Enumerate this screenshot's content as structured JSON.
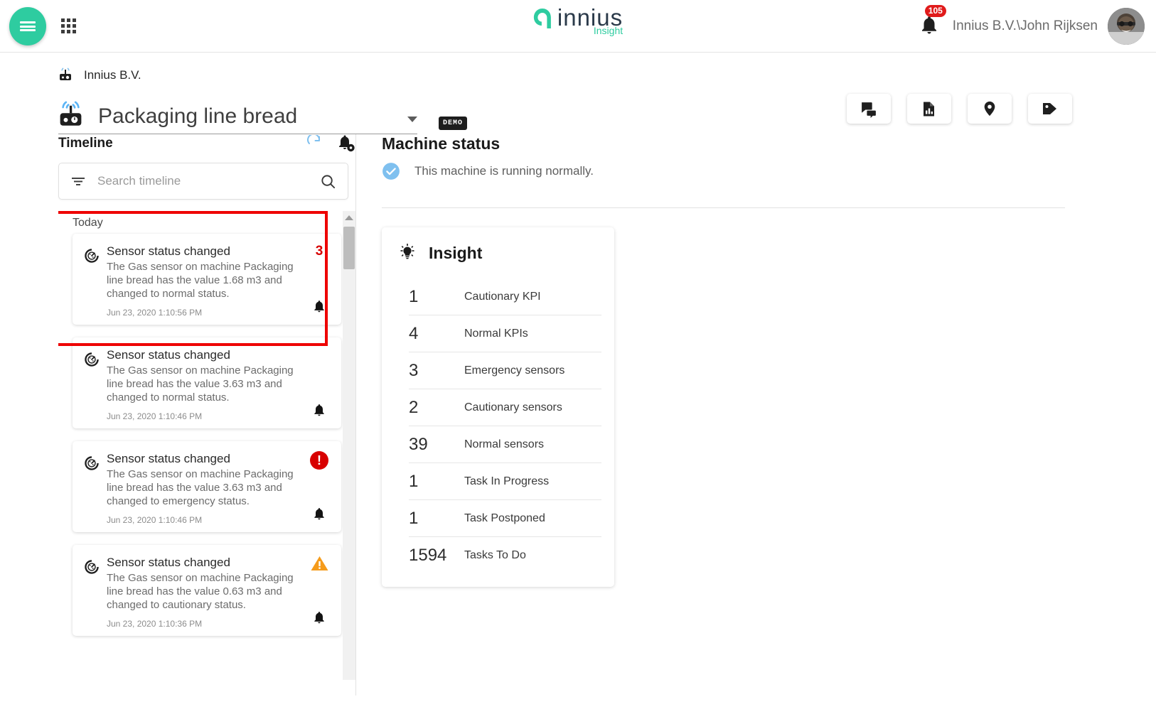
{
  "header": {
    "menu_icon": "hamburger-icon",
    "apps_icon": "apps-grid-icon",
    "brand_word": "innius",
    "brand_sub": "Insight",
    "notification_count": "105",
    "user_name": "Innius B.V.\\John Rijksen"
  },
  "page": {
    "breadcrumb": "Innius B.V.",
    "machine_title": "Packaging line bread",
    "demo_chip": "DEMO",
    "actions": [
      {
        "name": "comments-button",
        "icon": "chat-bubbles-icon"
      },
      {
        "name": "reports-button",
        "icon": "document-chart-icon"
      },
      {
        "name": "location-button",
        "icon": "map-pin-icon"
      },
      {
        "name": "tags-button",
        "icon": "tag-icon"
      }
    ]
  },
  "timeline": {
    "title": "Timeline",
    "refresh_icon": "refresh-icon",
    "settings_icon": "bell-settings-icon",
    "search_placeholder": "Search timeline",
    "search_value": "",
    "filter_icon": "filter-icon",
    "search_icon": "search-icon",
    "group_label": "Today",
    "cards": [
      {
        "title": "Sensor status changed",
        "desc": "The Gas sensor on machine Packaging line bread has the value 1.68 m3 and changed to normal status.",
        "time": "Jun 23, 2020 1:10:56 PM",
        "badge_count": "3",
        "status": "count"
      },
      {
        "title": "Sensor status changed",
        "desc": "The Gas sensor on machine Packaging line bread has the value 3.63 m3 and changed to normal status.",
        "time": "Jun 23, 2020 1:10:46 PM",
        "badge_count": "",
        "status": "none"
      },
      {
        "title": "Sensor status changed",
        "desc": "The Gas sensor on machine Packaging line bread has the value 3.63 m3 and changed to emergency status.",
        "time": "Jun 23, 2020 1:10:46 PM",
        "badge_count": "!",
        "status": "emergency"
      },
      {
        "title": "Sensor status changed",
        "desc": "The Gas sensor on machine Packaging line bread has the value 0.63 m3 and changed to cautionary status.",
        "time": "Jun 23, 2020 1:10:36 PM",
        "badge_count": "",
        "status": "cautionary"
      }
    ]
  },
  "machine_status": {
    "title": "Machine status",
    "status_icon": "check-circle-icon",
    "status_text": "This machine is running normally."
  },
  "insight": {
    "title": "Insight",
    "icon": "lightbulb-icon",
    "rows": [
      {
        "value": "1",
        "label": "Cautionary KPI"
      },
      {
        "value": "4",
        "label": "Normal KPIs"
      },
      {
        "value": "3",
        "label": "Emergency sensors"
      },
      {
        "value": "2",
        "label": "Cautionary sensors"
      },
      {
        "value": "39",
        "label": "Normal sensors"
      },
      {
        "value": "1",
        "label": "Task In Progress"
      },
      {
        "value": "1",
        "label": "Task Postponed"
      },
      {
        "value": "1594",
        "label": "Tasks To Do"
      }
    ]
  },
  "colors": {
    "accent_green": "#2ecca0",
    "brand_navy": "#2b3a4a",
    "alert_red": "#d80000",
    "warning_orange": "#f59b1b",
    "info_blue": "#7fc0ef",
    "highlight_red": "#ee0000"
  }
}
